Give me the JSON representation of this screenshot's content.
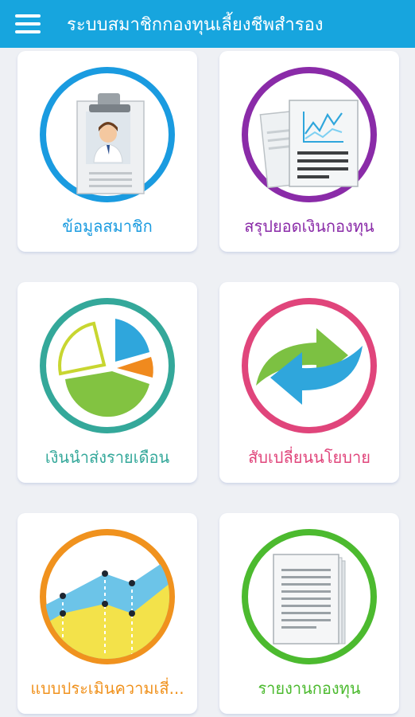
{
  "app": {
    "title": "ระบบสมาชิกกองทุนเลี้ยงชีพสำรอง"
  },
  "menu": [
    {
      "label": "ข้อมูลสมาชิก",
      "color": "#1a9be0",
      "icon": "member-id-badge-icon"
    },
    {
      "label": "สรุปยอดเงินกองทุน",
      "color": "#8a2ba8",
      "icon": "fund-summary-document-icon"
    },
    {
      "label": "เงินนำส่งรายเดือน",
      "color": "#34a89a",
      "icon": "monthly-contribution-pie-chart-icon"
    },
    {
      "label": "สับเปลี่ยนนโยบาย",
      "color": "#e0457b",
      "icon": "switch-policy-arrows-icon"
    },
    {
      "label": "แบบประเมินความเสี่...",
      "color": "#f0921e",
      "icon": "risk-assessment-area-chart-icon"
    },
    {
      "label": "รายงานกองทุน",
      "color": "#4cba2f",
      "icon": "fund-report-papers-icon"
    }
  ]
}
